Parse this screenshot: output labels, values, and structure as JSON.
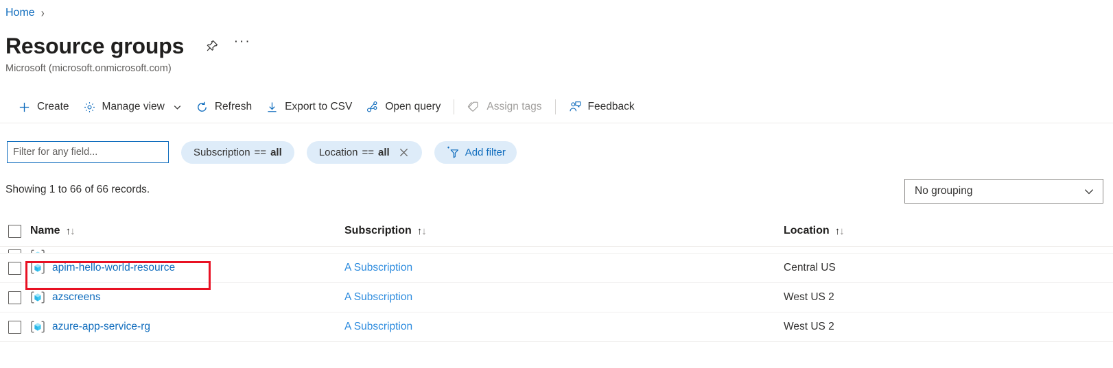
{
  "breadcrumb": {
    "home": "Home",
    "separator": "›"
  },
  "header": {
    "title": "Resource groups",
    "subtitle": "Microsoft (microsoft.onmicrosoft.com)",
    "pin_icon": "pin-icon",
    "more_icon": "ellipsis-icon",
    "more_label": "···"
  },
  "commandbar": {
    "items": [
      {
        "label": "Create",
        "icon": "plus-icon",
        "disabled": false,
        "chevron": false
      },
      {
        "label": "Manage view",
        "icon": "gear-icon",
        "disabled": false,
        "chevron": true
      },
      {
        "label": "Refresh",
        "icon": "refresh-icon",
        "disabled": false,
        "chevron": false
      },
      {
        "label": "Export to CSV",
        "icon": "download-icon",
        "disabled": false,
        "chevron": false
      },
      {
        "label": "Open query",
        "icon": "open-query-icon",
        "disabled": false,
        "chevron": false
      },
      {
        "label": "Assign tags",
        "icon": "tag-icon",
        "disabled": true,
        "chevron": false
      },
      {
        "label": "Feedback",
        "icon": "feedback-icon",
        "disabled": false,
        "chevron": false
      }
    ]
  },
  "filters": {
    "search_placeholder": "Filter for any field...",
    "search_value": "",
    "pills": [
      {
        "field": "Subscription",
        "operator": "==",
        "value": "all",
        "removable": false
      },
      {
        "field": "Location",
        "operator": "==",
        "value": "all",
        "removable": true
      }
    ],
    "add_filter_label": "Add filter",
    "add_filter_icon": "add-filter-icon"
  },
  "results": {
    "records_text": "Showing 1 to 66 of 66 records.",
    "grouping_value": "No grouping",
    "grouping_chevron_icon": "chevron-down-icon"
  },
  "table": {
    "columns": [
      {
        "label": "Name",
        "sort_icon": "sort-arrows-icon"
      },
      {
        "label": "Subscription",
        "sort_icon": "sort-arrows-icon"
      },
      {
        "label": "Location",
        "sort_icon": "sort-arrows-icon"
      }
    ],
    "rows": [
      {
        "name": "",
        "subscription": "",
        "location": "",
        "clipped": true,
        "highlighted": false
      },
      {
        "name": "apim-hello-world-resource",
        "subscription": "A Subscription",
        "location": "Central US",
        "clipped": false,
        "highlighted": true
      },
      {
        "name": "azscreens",
        "subscription": "A Subscription",
        "location": "West US 2",
        "clipped": false,
        "highlighted": false
      },
      {
        "name": "azure-app-service-rg",
        "subscription": "A Subscription",
        "location": "West US 2",
        "clipped": false,
        "highlighted": false
      }
    ],
    "row_icon": "resource-group-icon"
  },
  "annotation": {
    "highlight_color": "#e81123",
    "target": "apim-hello-world-resource"
  },
  "colors": {
    "accent": "#0f6cbd",
    "link": "#2c8bde",
    "pill_bg": "#deecf9",
    "text": "#323130"
  }
}
